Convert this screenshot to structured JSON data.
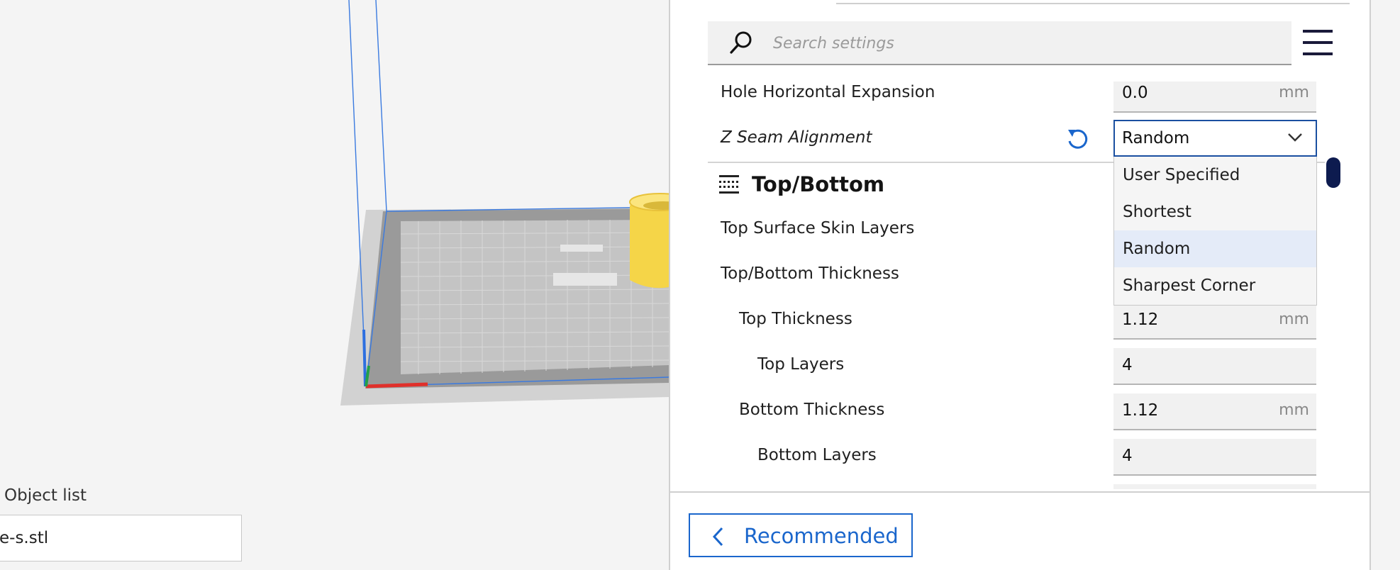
{
  "viewport": {
    "object_list_label": "Object list",
    "object_list_item": "e-s.stl"
  },
  "search": {
    "placeholder": "Search settings"
  },
  "settings": {
    "hole_expansion": {
      "label": "Hole Horizontal Expansion",
      "value": "0.0",
      "unit": "mm"
    },
    "z_seam": {
      "label": "Z Seam Alignment",
      "value": "Random"
    },
    "category": {
      "title": "Top/Bottom"
    },
    "top_surface_skin": {
      "label": "Top Surface Skin Layers"
    },
    "top_bottom_thickness": {
      "label": "Top/Bottom Thickness"
    },
    "top_thickness": {
      "label": "Top Thickness",
      "value": "1.12",
      "unit": "mm"
    },
    "top_layers": {
      "label": "Top Layers",
      "value": "4"
    },
    "bottom_thickness": {
      "label": "Bottom Thickness",
      "value": "1.12",
      "unit": "mm"
    },
    "bottom_layers": {
      "label": "Bottom Layers",
      "value": "4"
    }
  },
  "dropdown": {
    "options": [
      "User Specified",
      "Shortest",
      "Random",
      "Sharpest Corner"
    ],
    "selected": "Random"
  },
  "footer": {
    "recommended_label": "Recommended"
  },
  "colors": {
    "accent": "#1a66cc",
    "scroll_thumb": "#0d1b4f",
    "selected_option_bg": "#e4ebf8"
  }
}
